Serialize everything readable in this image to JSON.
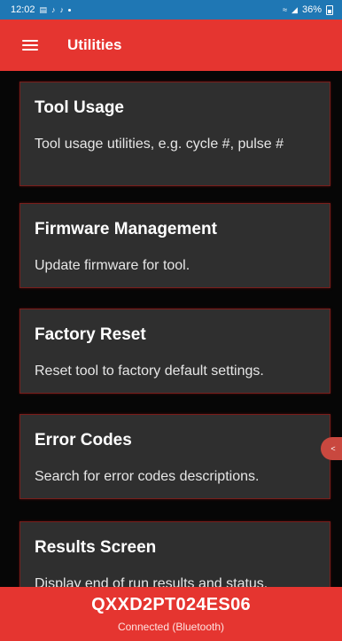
{
  "status_bar": {
    "time": "12:02",
    "battery_text": "36%"
  },
  "app_bar": {
    "title": "Utilities",
    "menu_icon": "hamburger-menu-icon"
  },
  "cards": [
    {
      "title": "Tool Usage",
      "description": "Tool usage utilities, e.g. cycle #, pulse #"
    },
    {
      "title": "Firmware Management",
      "description": "Update firmware for tool."
    },
    {
      "title": "Factory Reset",
      "description": "Reset tool to factory default settings."
    },
    {
      "title": "Error Codes",
      "description": "Search for error codes descriptions."
    },
    {
      "title": "Results Screen",
      "description": "Display end of run results and status."
    }
  ],
  "side_tab": {
    "label": "<"
  },
  "device": {
    "id": "QXXD2PT024ES06",
    "connection": "Connected (Bluetooth)"
  },
  "colors": {
    "accent_red": "#e53530",
    "status_blue": "#1f77b4",
    "card_bg": "#2f2f2f",
    "card_border": "#7a1e1b"
  }
}
